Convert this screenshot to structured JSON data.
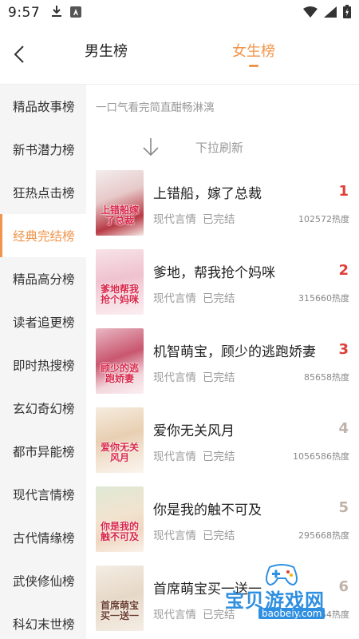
{
  "status_bar": {
    "time": "9:57"
  },
  "header": {
    "tabs": [
      {
        "label": "男生榜",
        "active": false
      },
      {
        "label": "女生榜",
        "active": true
      }
    ]
  },
  "sidebar": {
    "items": [
      {
        "label": "精品故事榜"
      },
      {
        "label": "新书潜力榜"
      },
      {
        "label": "狂热点击榜"
      },
      {
        "label": "经典完结榜",
        "active": true
      },
      {
        "label": "精品高分榜"
      },
      {
        "label": "读者追更榜"
      },
      {
        "label": "即时热搜榜"
      },
      {
        "label": "玄幻奇幻榜"
      },
      {
        "label": "都市异能榜"
      },
      {
        "label": "现代言情榜"
      },
      {
        "label": "古代情缘榜"
      },
      {
        "label": "武侠修仙榜"
      },
      {
        "label": "科幻末世榜"
      }
    ]
  },
  "main": {
    "description": "一口气看完简直酣畅淋漓",
    "pull_refresh": "下拉刷新",
    "books": [
      {
        "title": "上错船，嫁了总裁",
        "genre": "现代言情",
        "status": "已完结",
        "heat": "102572热度",
        "rank": "1",
        "cover_text": "上错船嫁了总裁"
      },
      {
        "title": "爹地，帮我抢个妈咪",
        "genre": "现代言情",
        "status": "已完结",
        "heat": "315660热度",
        "rank": "2",
        "cover_text": "爹地帮我抢个妈咪"
      },
      {
        "title": "机智萌宝，顾少的逃跑娇妻",
        "genre": "现代言情",
        "status": "已完结",
        "heat": "85658热度",
        "rank": "3",
        "cover_text": "顾少的逃跑娇妻"
      },
      {
        "title": "爱你无关风月",
        "genre": "现代言情",
        "status": "已完结",
        "heat": "1056586热度",
        "rank": "4",
        "cover_text": "爱你无关风月"
      },
      {
        "title": "你是我的触不可及",
        "genre": "现代言情",
        "status": "已完结",
        "heat": "295668热度",
        "rank": "5",
        "cover_text": "你是我的触不可及"
      },
      {
        "title": "首席萌宝买一送一",
        "genre": "现代言情",
        "status": "已完结",
        "heat": "5654热度",
        "rank": "6",
        "cover_text": "首席萌宝买一送一"
      }
    ]
  },
  "watermark": {
    "text": "宝贝游戏网",
    "url": "baobeiy.com"
  },
  "colors": {
    "accent": "#f0954b",
    "rank_top": "#e0403a",
    "rank_other": "#bfb3a8"
  }
}
